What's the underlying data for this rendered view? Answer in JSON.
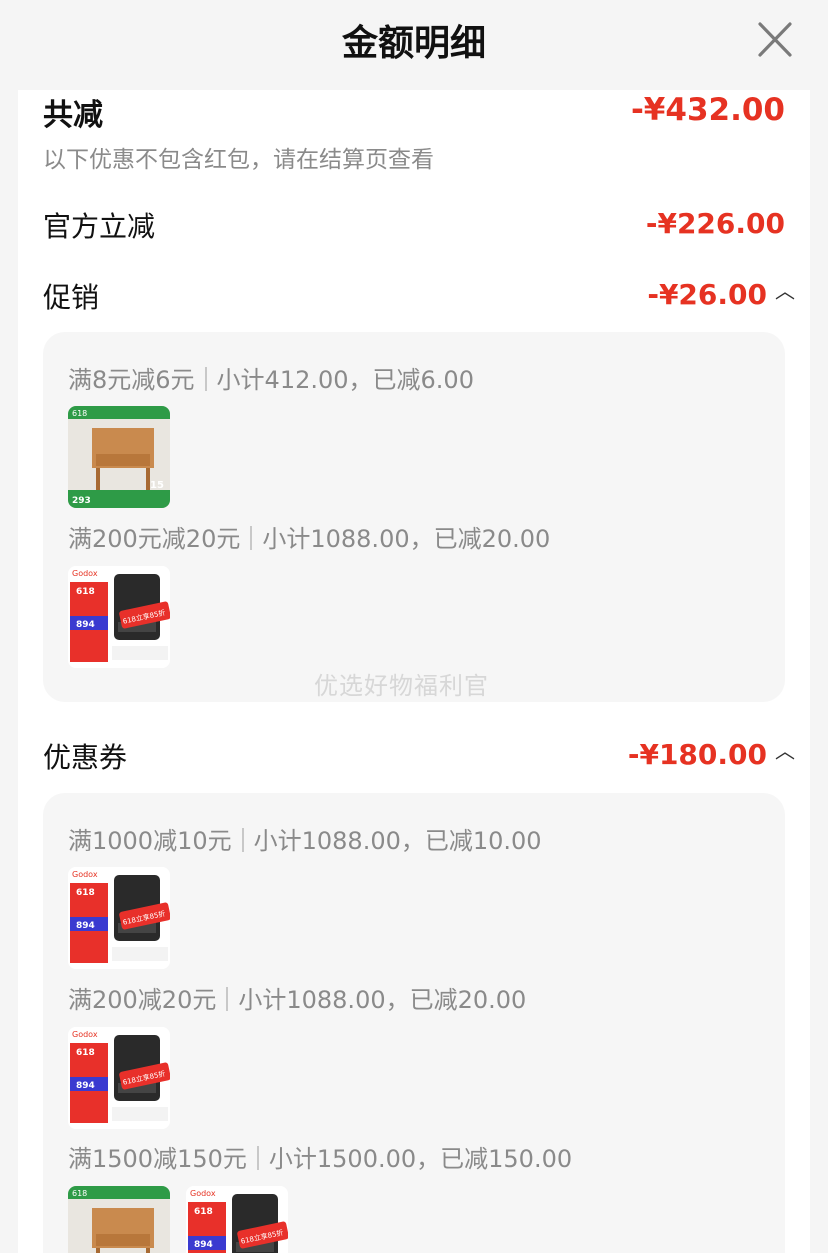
{
  "header": {
    "title": "金额明细",
    "close_icon": "close-icon"
  },
  "summary": {
    "label": "共减",
    "amount": "-¥432.00",
    "note": "以下优惠不包含红包，请在结算页查看"
  },
  "official": {
    "label": "官方立减",
    "amount": "-¥226.00"
  },
  "promotion": {
    "label": "促销",
    "amount": "-¥26.00",
    "chevron": "chevron-up-icon",
    "groups": [
      {
        "rule": "满8元减6元",
        "detail": "小计412.00，已减6.00",
        "products": [
          "side-table"
        ]
      },
      {
        "rule": "满200元减20元",
        "detail": "小计1088.00，已减20.00",
        "products": [
          "flash-unit"
        ]
      }
    ]
  },
  "coupon": {
    "label": "优惠券",
    "amount": "-¥180.00",
    "chevron": "chevron-up-icon",
    "groups": [
      {
        "rule": "满1000减10元",
        "detail": "小计1088.00，已减10.00",
        "products": [
          "flash-unit"
        ]
      },
      {
        "rule": "满200减20元",
        "detail": "小计1088.00，已减20.00",
        "products": [
          "flash-unit"
        ]
      },
      {
        "rule": "满1500减150元",
        "detail": "小计1500.00，已减150.00",
        "products": [
          "side-table",
          "flash-unit"
        ]
      }
    ]
  },
  "thumb_text": {
    "tag_618": "618",
    "table_price": "293",
    "table_badge": "15",
    "flash_brand": "Godox",
    "flash_price": "894",
    "flash_promo": "618立享85折"
  },
  "watermark": "优选好物福利官",
  "colors": {
    "accent": "#e63222",
    "muted": "#8a8a8a",
    "card": "#f6f6f6"
  }
}
